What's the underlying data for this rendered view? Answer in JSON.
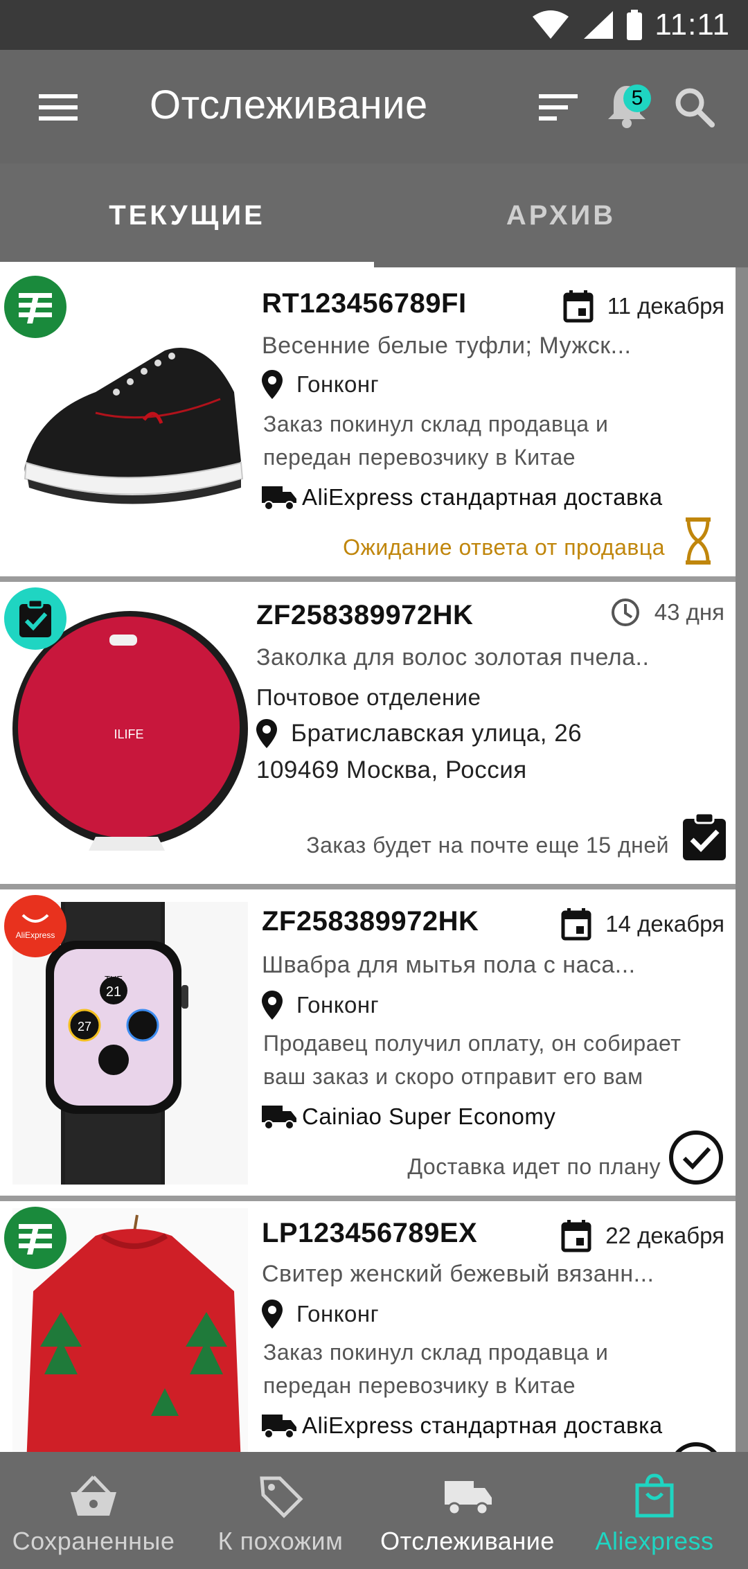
{
  "status_bar": {
    "time": "11:11"
  },
  "app_bar": {
    "title": "Отслеживание",
    "notification_count": "5"
  },
  "tabs": [
    {
      "label": "ТЕКУЩИЕ",
      "selected": true
    },
    {
      "label": "АРХИВ",
      "selected": false
    }
  ],
  "parcels": [
    {
      "track": "RT123456789FI",
      "date_icon": "calendar-icon",
      "date": "11 декабря",
      "title": "Весенние белые туфли; Мужск...",
      "location": "Гонконг",
      "description": "Заказ покинул склад продавца и передан перевозчику в Китае",
      "shipping": "AliExpress стандартная доставка",
      "status": "Ожидание ответа от продавца",
      "status_color": "#c0860c",
      "status_icon": "hourglass-icon",
      "source_logo": "china-post-logo",
      "image": "black-sneaker"
    },
    {
      "track": "ZF258389972HK",
      "date_icon": "clock-icon",
      "date": "43 дня",
      "title": "Заколка для волос золотая пчела..",
      "post_office": "Почтовое отделение",
      "address_line1": "Братиславская улица, 26",
      "address_line2": "109469 Москва, Россия",
      "status": "Заказ будет на почте еще 15 дней",
      "status_color": "#555555",
      "status_icon": "clipboard-check-icon",
      "source_logo": "delivered-check-logo",
      "image": "red-robot-vacuum",
      "product_brand": "ILIFE"
    },
    {
      "track": "ZF258389972HK",
      "date_icon": "calendar-icon",
      "date": "14 декабря",
      "title": "Швабра для мытья пола с наса...",
      "location": "Гонконг",
      "description": "Продавец получил оплату, он собирает ваш заказ и скоро отправит его вам",
      "shipping": "Cainiao Super Economy",
      "status": "Доставка идет по плану",
      "status_color": "#555555",
      "status_icon": "circle-check-icon",
      "source_logo": "aliexpress-logo",
      "source_logo_text": "AliExpress",
      "image": "smart-watch",
      "watch_day": "TUE",
      "watch_date": "21",
      "watch_temp": "27"
    },
    {
      "track": "LP123456789EX",
      "date_icon": "calendar-icon",
      "date": "22 декабря",
      "title": "Свитер женский бежевый вязанн...",
      "location": "Гонконг",
      "description": "Заказ покинул склад продавца и передан перевозчику в Китае",
      "shipping": "AliExpress стандартная доставка",
      "status_icon": "circle-check-icon",
      "source_logo": "china-post-logo",
      "image": "red-christmas-sweater"
    }
  ],
  "bottom_nav": [
    {
      "label": "Сохраненные",
      "icon": "basket-icon"
    },
    {
      "label": "К похожим",
      "icon": "tag-icon"
    },
    {
      "label": "Отслеживание",
      "icon": "truck-icon"
    },
    {
      "label": "Aliexpress",
      "icon": "shopping-bag-icon",
      "active": true
    }
  ],
  "colors": {
    "accent": "#1fd5c2",
    "app_bar": "#666666",
    "status_bar": "#3a3a3a",
    "china_post_green": "#1a8a3c",
    "aliexpress_red": "#e8321e"
  }
}
